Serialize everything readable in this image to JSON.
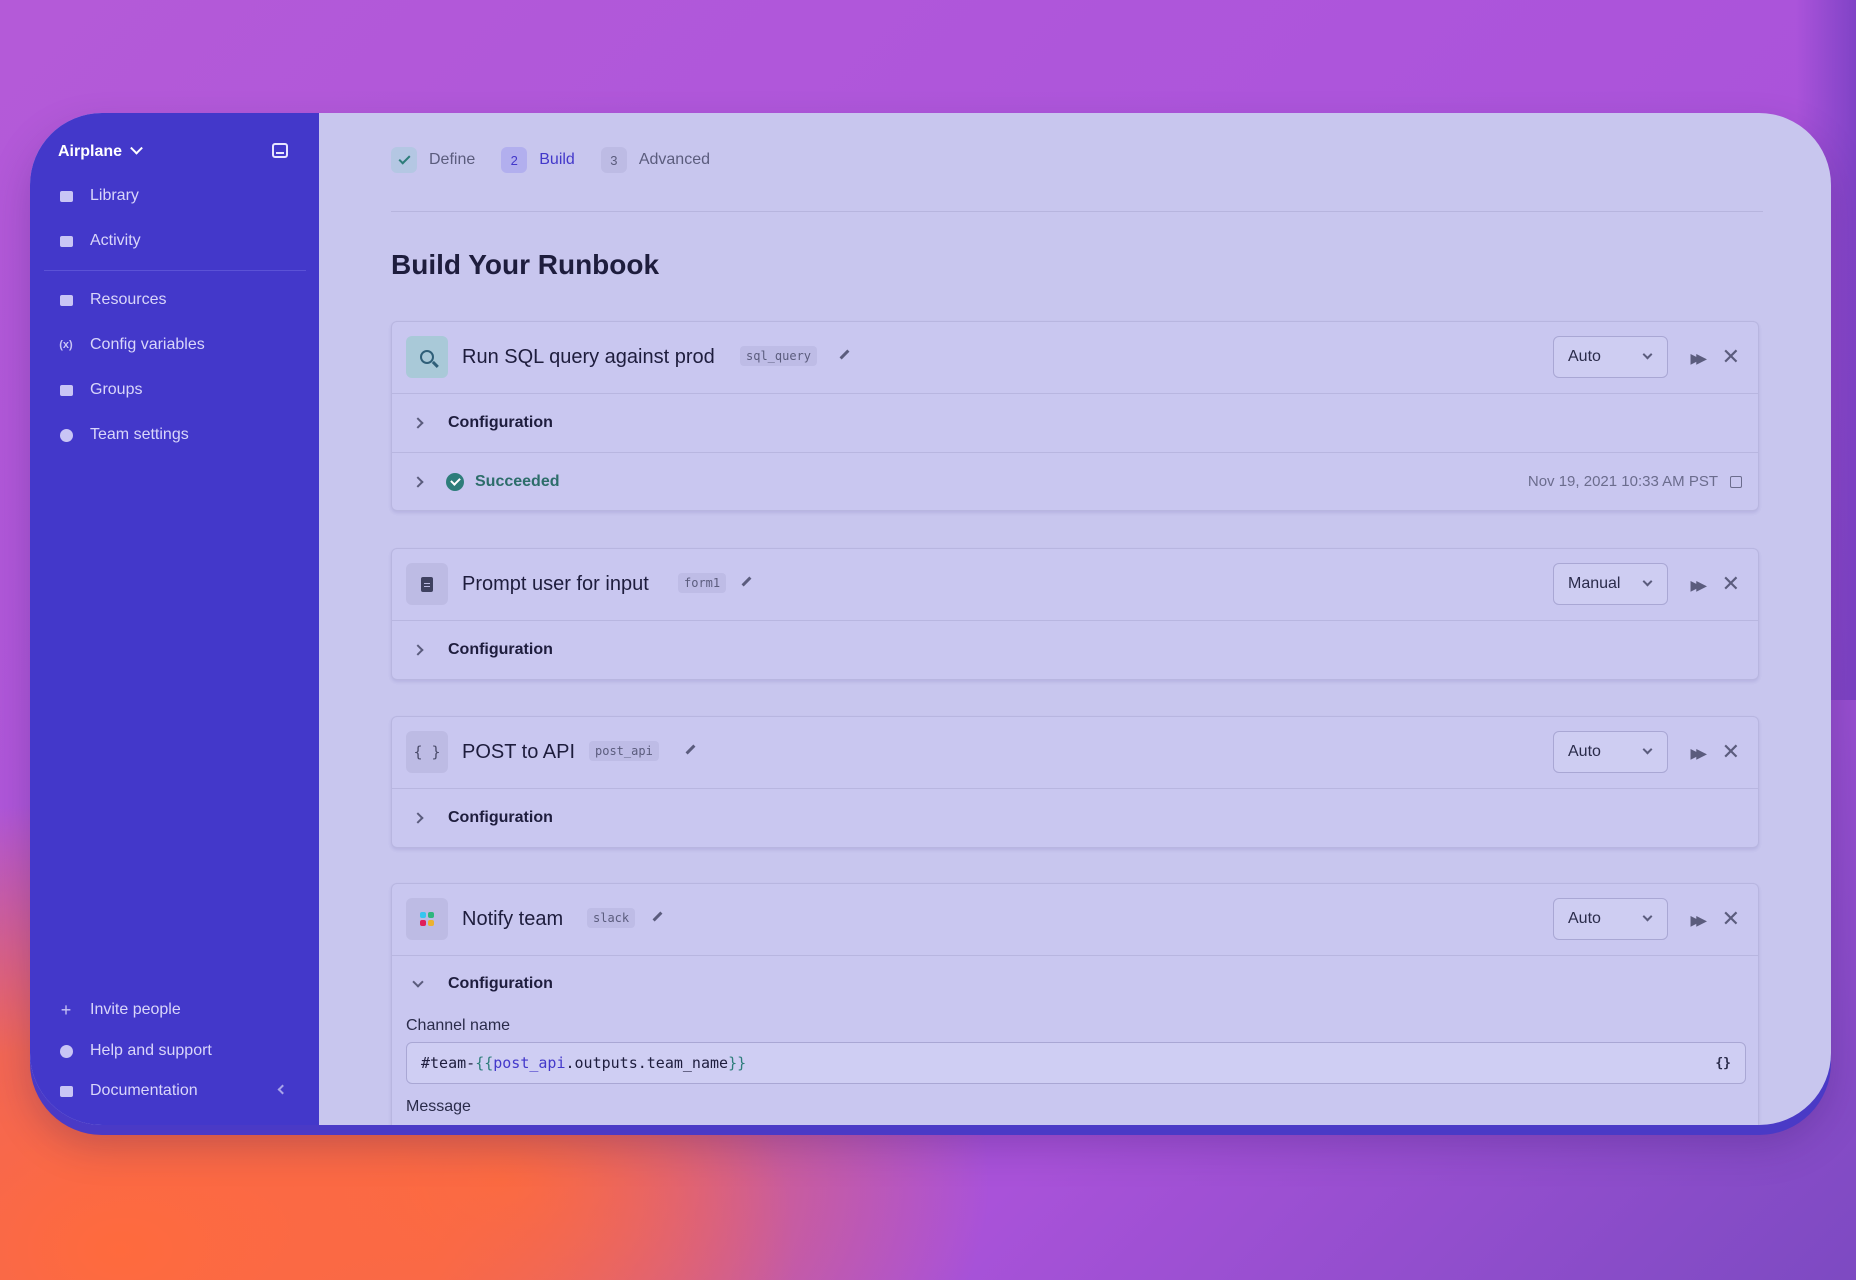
{
  "sidebar": {
    "workspace": "Airplane",
    "primary": [
      {
        "label": "Library"
      },
      {
        "label": "Activity"
      }
    ],
    "secondary": [
      {
        "label": "Resources"
      },
      {
        "label": "Config variables",
        "icon_text": "(x)"
      },
      {
        "label": "Groups"
      },
      {
        "label": "Team settings"
      }
    ],
    "footer": [
      {
        "label": "Invite people",
        "icon_text": "+"
      },
      {
        "label": "Help and support"
      },
      {
        "label": "Documentation"
      }
    ]
  },
  "steps": [
    {
      "num": "",
      "label": "Define",
      "state": "done"
    },
    {
      "num": "2",
      "label": "Build",
      "state": "active"
    },
    {
      "num": "3",
      "label": "Advanced",
      "state": "todo"
    }
  ],
  "page_title": "Build Your Runbook",
  "blocks": [
    {
      "title": "Run SQL query against prod",
      "slug": "sql_query",
      "mode": "Auto",
      "config_label": "Configuration",
      "status": "Succeeded",
      "timestamp": "Nov 19, 2021 10:33 AM PST"
    },
    {
      "title": "Prompt user for input",
      "slug": "form1",
      "mode": "Manual",
      "config_label": "Configuration"
    },
    {
      "title": "POST to API",
      "slug": "post_api",
      "mode": "Auto",
      "config_label": "Configuration",
      "icon_text": "{ }"
    },
    {
      "title": "Notify team",
      "slug": "slack",
      "mode": "Auto",
      "config_label": "Configuration",
      "channel_label": "Channel name",
      "channel_value": {
        "prefix": "#team-",
        "open": "{{",
        "ref": "post_api",
        "path": ".outputs.team_name",
        "close": "}}"
      },
      "template_icon": "{}",
      "message_label": "Message"
    }
  ],
  "colors": {
    "sidebar": "#4338ca",
    "success": "#2d7d7a",
    "accent": "#4338ca"
  }
}
